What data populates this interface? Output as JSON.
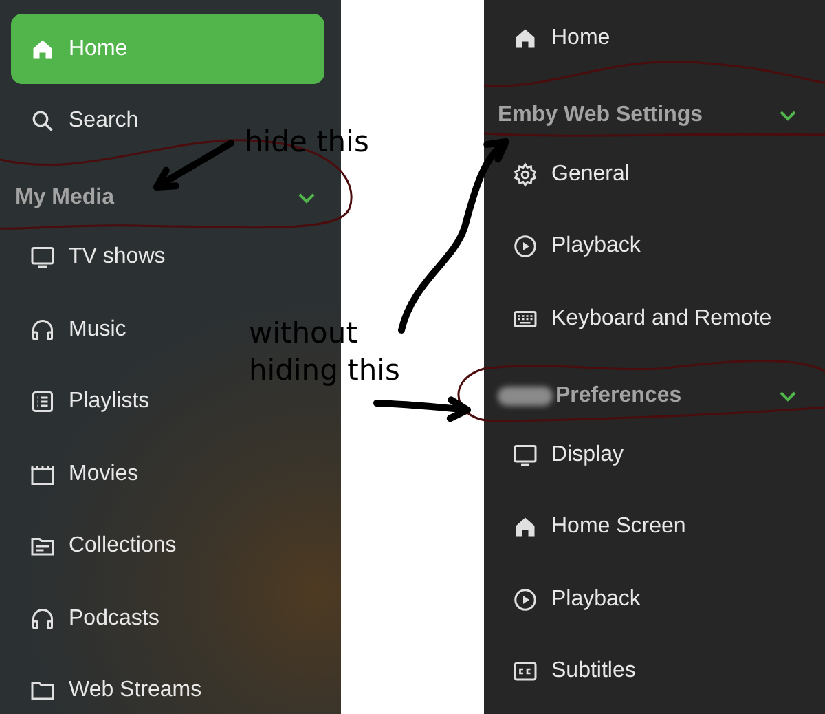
{
  "left_sidebar": {
    "items": [
      {
        "kind": "item",
        "label": "Home",
        "selected": true
      },
      {
        "kind": "item",
        "label": "Search",
        "selected": false
      },
      {
        "kind": "header",
        "label": "My Media",
        "expanded": true
      },
      {
        "kind": "item",
        "label": "TV shows",
        "selected": false
      },
      {
        "kind": "item",
        "label": "Music",
        "selected": false
      },
      {
        "kind": "item",
        "label": "Playlists",
        "selected": false
      },
      {
        "kind": "item",
        "label": "Movies",
        "selected": false
      },
      {
        "kind": "item",
        "label": "Collections",
        "selected": false
      },
      {
        "kind": "item",
        "label": "Podcasts",
        "selected": false
      },
      {
        "kind": "item",
        "label": "Web Streams",
        "selected": false
      }
    ]
  },
  "right_sidebar": {
    "items": [
      {
        "kind": "item",
        "label": "Home",
        "selected": false
      },
      {
        "kind": "header",
        "label": "Emby Web Settings",
        "expanded": true
      },
      {
        "kind": "item",
        "label": "General",
        "selected": false
      },
      {
        "kind": "item",
        "label": "Playback",
        "selected": false
      },
      {
        "kind": "item",
        "label": "Keyboard and Remote",
        "selected": false
      },
      {
        "kind": "header",
        "label": "Preferences",
        "expanded": true,
        "redacted": true
      },
      {
        "kind": "item",
        "label": "Display",
        "selected": false
      },
      {
        "kind": "item",
        "label": "Home Screen",
        "selected": false
      },
      {
        "kind": "item",
        "label": "Playback",
        "selected": false
      },
      {
        "kind": "item",
        "label": "Subtitles",
        "selected": false
      }
    ]
  },
  "annotations": [
    {
      "text": "hide this"
    },
    {
      "text": "without\nhiding this"
    }
  ]
}
